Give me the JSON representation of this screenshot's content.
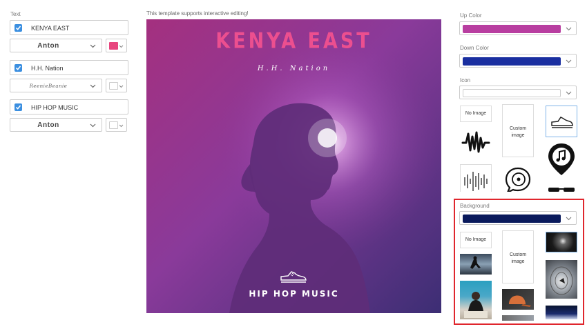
{
  "left_panel": {
    "section_label": "Text",
    "rows": [
      {
        "text": "KENYA EAST",
        "font": "Anton",
        "color": "#e8457e",
        "checked": true
      },
      {
        "text": "H.H. Nation",
        "font": "ReenieBeanie",
        "color": "",
        "checked": true
      },
      {
        "text": "HIP HOP MUSIC",
        "font": "Anton",
        "color": "",
        "checked": true
      }
    ]
  },
  "center": {
    "notice": "This template supports interactive editing!",
    "poster": {
      "title": "KENYA EAST",
      "subtitle": "H.H. Nation",
      "footer": "HIP HOP MUSIC",
      "title_color": "#ec4f8f",
      "bg_colors": [
        "#b43b93",
        "#4a2f7a"
      ]
    }
  },
  "right_panel": {
    "up_color": {
      "label": "Up Color",
      "value": "#b83ea0"
    },
    "down_color": {
      "label": "Down Color",
      "value": "#1a2fa0"
    },
    "icon": {
      "label": "Icon",
      "no_image": "No Image",
      "custom_image": "Custom image"
    },
    "background": {
      "label": "Background",
      "value": "#0a1a5c",
      "no_image": "No Image",
      "custom_image": "Custom image"
    }
  },
  "highlight_color": "#e0262d"
}
